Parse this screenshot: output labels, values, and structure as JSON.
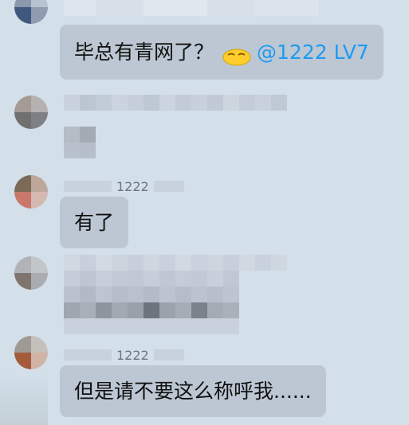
{
  "messages": [
    {
      "id": "m1",
      "text": "毕总有青网了？",
      "emoji_icon": "sleeping-face-emoji-icon",
      "mention": "@1222 LV7"
    },
    {
      "id": "m2",
      "sender_label": "1222",
      "text": "有了"
    },
    {
      "id": "m3",
      "sender_label": "1222",
      "text": "但是请不要这么称呼我......"
    }
  ],
  "colors": {
    "background": "#d3dfe9",
    "bubble": "#bcc7d3",
    "mention": "#1d9bf0"
  }
}
